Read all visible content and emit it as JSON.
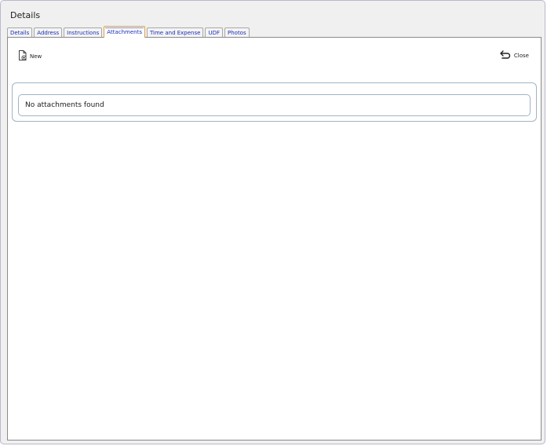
{
  "dialog": {
    "title": "Details"
  },
  "tabs": [
    {
      "label": "Details",
      "active": false
    },
    {
      "label": "Address",
      "active": false
    },
    {
      "label": "Instructions",
      "active": false
    },
    {
      "label": "Attachments",
      "active": true
    },
    {
      "label": "Time and Expense",
      "active": false
    },
    {
      "label": "UDF",
      "active": false
    },
    {
      "label": "Photos",
      "active": false
    }
  ],
  "toolbar": {
    "new_label": "New",
    "new_icon": "new-document-icon",
    "close_label": "Close",
    "close_icon": "undo-arrow-icon"
  },
  "attachments": {
    "empty_message": "No attachments found"
  },
  "colors": {
    "tab_text": "#1c2fb8",
    "active_tab_border": "#e0a040",
    "box_border": "#a0b4c4"
  }
}
